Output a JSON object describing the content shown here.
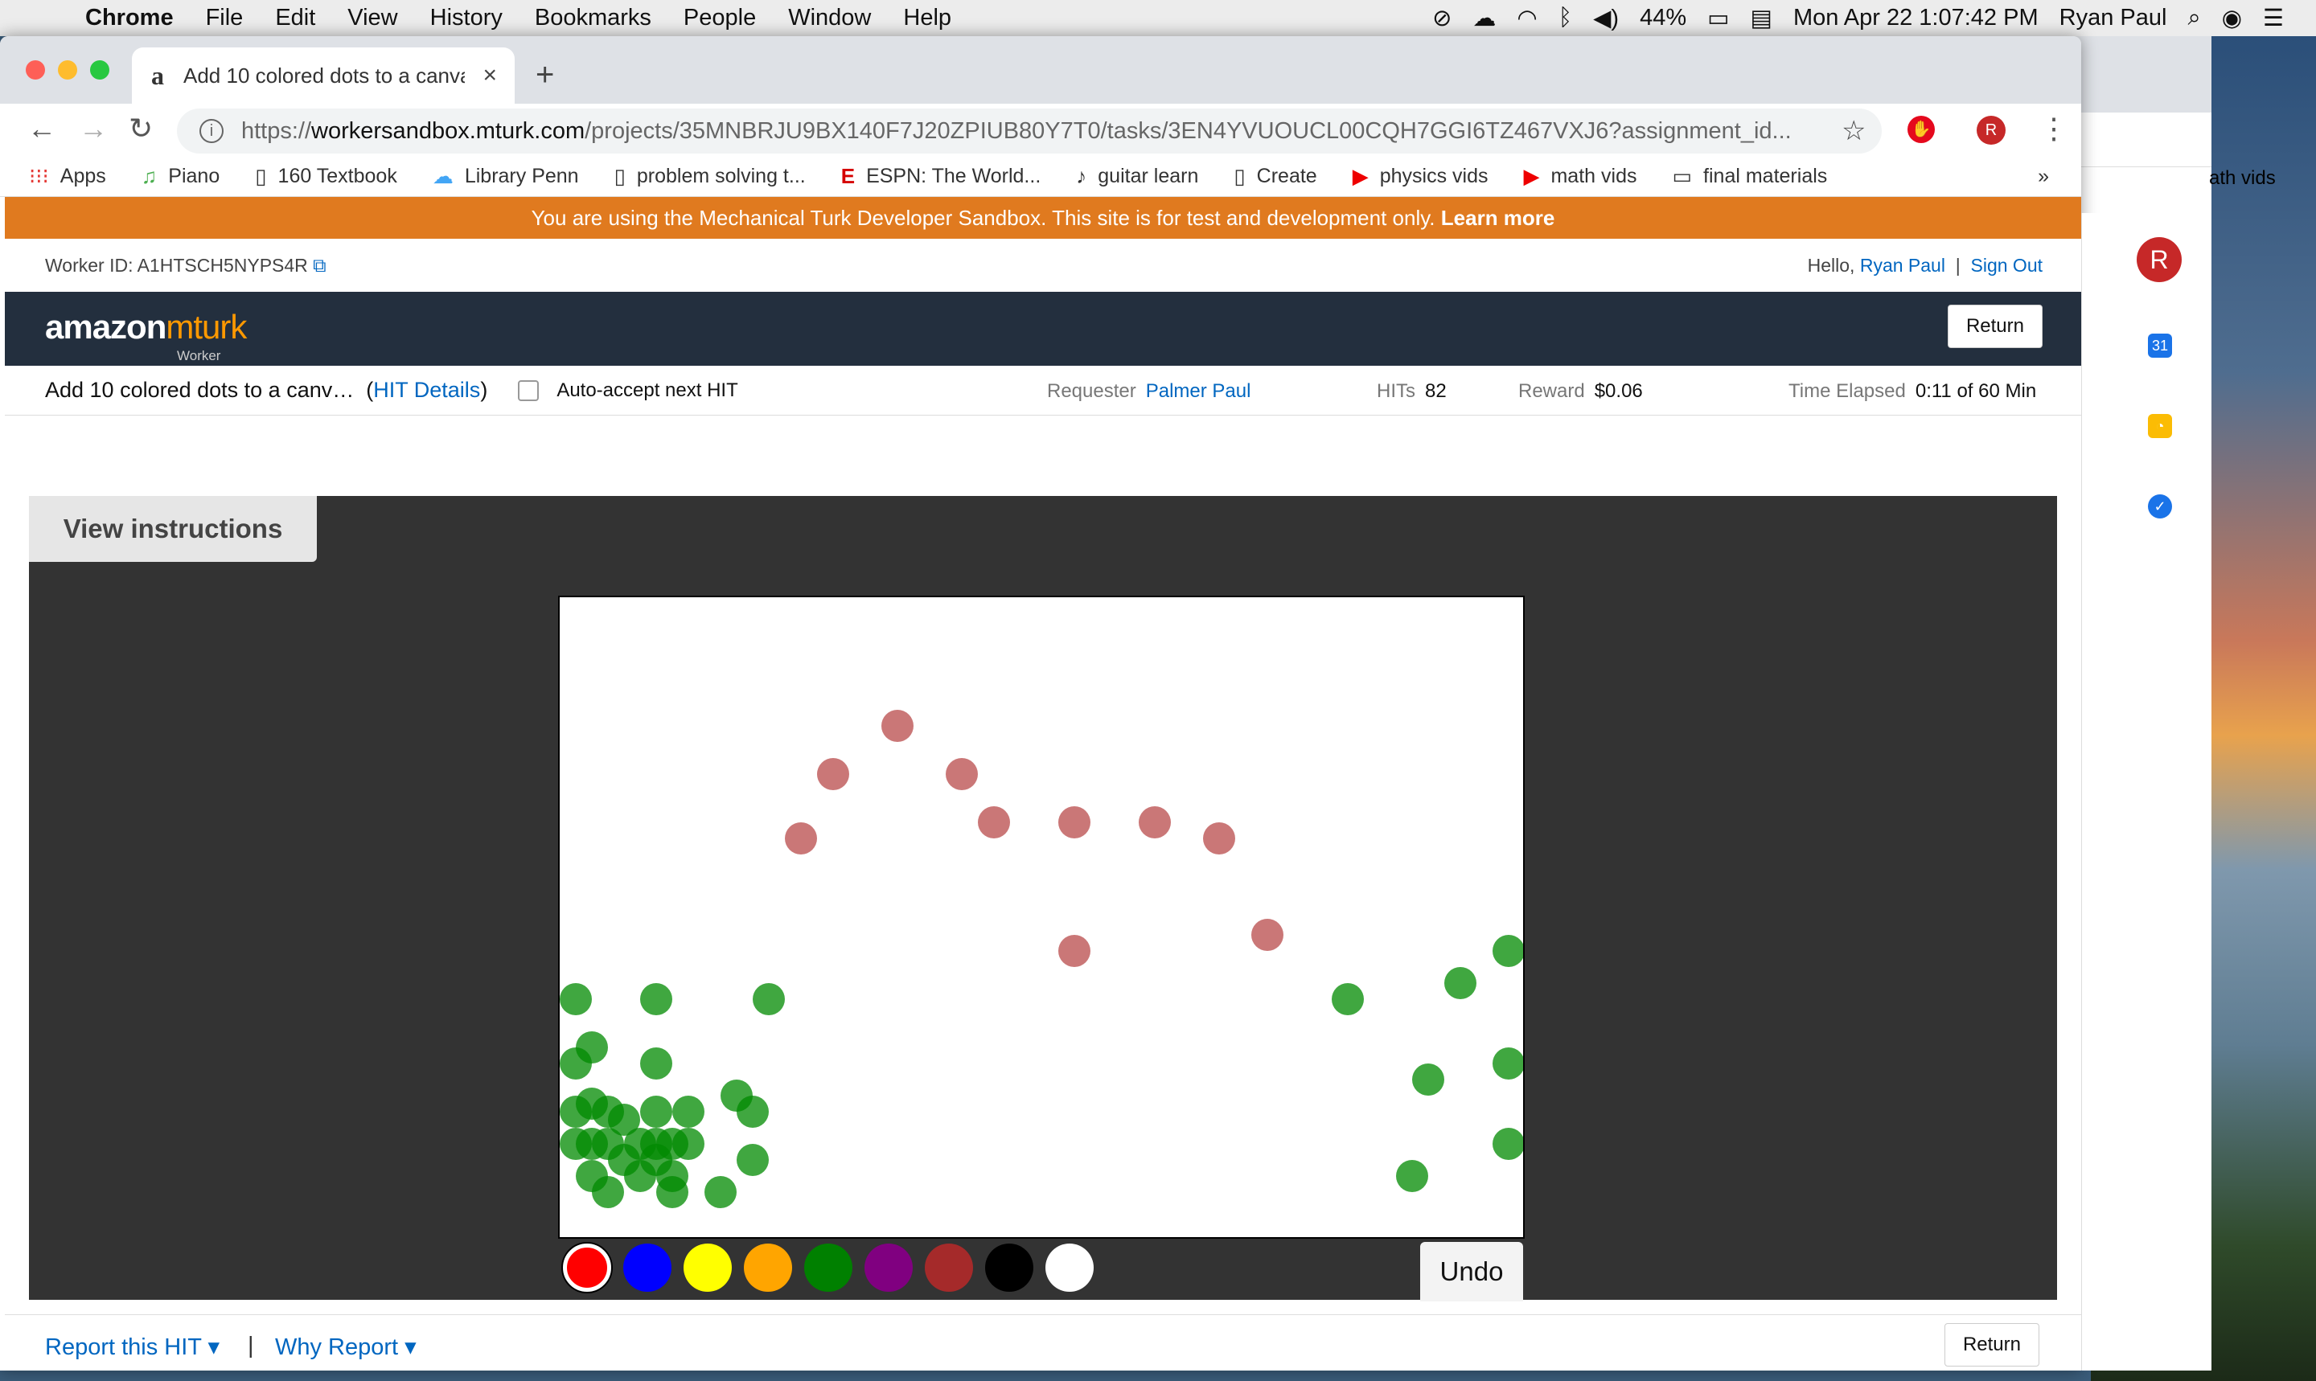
{
  "menubar": {
    "app": "Chrome",
    "items": [
      "File",
      "Edit",
      "View",
      "History",
      "Bookmarks",
      "People",
      "Window",
      "Help"
    ],
    "battery": "44%",
    "datetime": "Mon Apr 22  1:07:42 PM",
    "user": "Ryan Paul"
  },
  "browser": {
    "tab_title": "Add 10 colored dots to a canva",
    "url_host": "workersandbox.mturk.com",
    "url_prefix": "https://",
    "url_path": "/projects/35MNBRJU9BX140F7J20ZPIUB80Y7T0/tasks/3EN4YVUOUCL00CQH7GGI6TZ467VXJ6?assignment_id...",
    "profile_initial": "R",
    "bookmarks": [
      {
        "icon": "apps-grid-icon",
        "glyph": "⁝⁝⁝",
        "label": "Apps"
      },
      {
        "icon": "piano-icon",
        "glyph": "♫",
        "label": "Piano"
      },
      {
        "icon": "page-icon",
        "glyph": "▯",
        "label": "160 Textbook"
      },
      {
        "icon": "cloud-icon",
        "glyph": "☁",
        "label": "Library Penn"
      },
      {
        "icon": "page-icon",
        "glyph": "▯",
        "label": "problem solving t..."
      },
      {
        "icon": "espn-icon",
        "glyph": "E",
        "label": "ESPN: The World..."
      },
      {
        "icon": "guitar-icon",
        "glyph": "♪",
        "label": "guitar learn"
      },
      {
        "icon": "page-icon",
        "glyph": "▯",
        "label": "Create"
      },
      {
        "icon": "youtube-icon",
        "glyph": "▶",
        "label": "physics vids"
      },
      {
        "icon": "youtube-icon",
        "glyph": "▶",
        "label": "math vids"
      },
      {
        "icon": "folder-icon",
        "glyph": "▭",
        "label": "final materials"
      }
    ],
    "bookmarks_overflow": "»",
    "back_window_bookmark": "ath vids"
  },
  "page": {
    "banner_text": "You are using the Mechanical Turk Developer Sandbox. This site is for test and development only.",
    "banner_link": "Learn more",
    "worker_id": "Worker ID: A1HTSCH5NYPS4R",
    "hello": "Hello,",
    "user_name": "Ryan Paul",
    "sign_out": "Sign Out",
    "logo_amazon": "amazon",
    "logo_mturk": "mturk",
    "logo_sub": "Worker",
    "return_label": "Return",
    "hit_title": "Add 10 colored dots to a canv…",
    "hit_details_open": "(",
    "hit_details": "HIT Details",
    "hit_details_close": ")",
    "auto_accept": "Auto-accept next HIT",
    "requester_label": "Requester",
    "requester_value": "Palmer Paul",
    "hits_label": "HITs",
    "hits_value": "82",
    "reward_label": "Reward",
    "reward_value": "$0.06",
    "time_label": "Time Elapsed",
    "time_value": "0:11 of 60 Min",
    "view_instructions": "View instructions",
    "undo": "Undo",
    "report_hit": "Report this HIT ▾",
    "separator": "|",
    "why_report": "Why Report ▾",
    "palette": [
      "#ff0000",
      "#0000ff",
      "#ffff00",
      "#ffa500",
      "#008000",
      "#800080",
      "#a52a2a",
      "#000000",
      "#ffffff"
    ],
    "red_dot_color": "#b84a4a",
    "green_dot_color": "#008a00"
  }
}
